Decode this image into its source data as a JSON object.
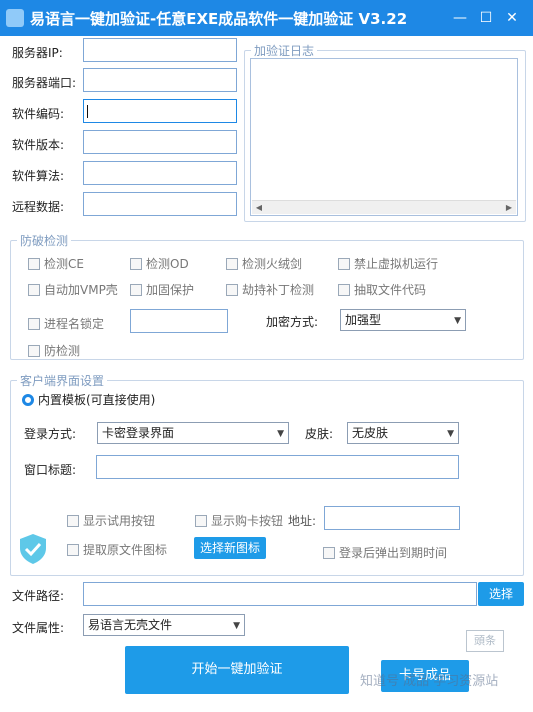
{
  "window": {
    "title": "易语言一键加验证-任意EXE成品软件一键加验证 V3.22",
    "min_glyph": "—",
    "max_glyph": "☐",
    "close_glyph": "✕"
  },
  "server": {
    "ip_label": "服务器IP:",
    "port_label": "服务器端口:",
    "code_label": "软件编码:",
    "version_label": "软件版本:",
    "algo_label": "软件算法:",
    "remote_label": "远程数据:"
  },
  "log": {
    "title": "加验证日志"
  },
  "protect": {
    "title": "防破检测",
    "items": [
      "检测CE",
      "检测OD",
      "检测火绒剑",
      "禁止虚拟机运行",
      "自动加VMP壳",
      "加固保护",
      "劫持补丁检测",
      "抽取文件代码",
      "进程名锁定",
      "防检测"
    ],
    "encrypt_label": "加密方式:",
    "encrypt_value": "加强型"
  },
  "client": {
    "title": "客户端界面设置",
    "template_label": "内置模板(可直接使用)",
    "login_label": "登录方式:",
    "login_value": "卡密登录界面",
    "skin_label": "皮肤:",
    "skin_value": "无皮肤",
    "window_title_label": "窗口标题:",
    "show_trial": "显示试用按钮",
    "show_buy": "显示购卡按钮",
    "address_label": "地址:",
    "extract_icon": "提取原文件图标",
    "choose_icon": "选择新图标",
    "popup_expire": "登录后弹出到期时间"
  },
  "file": {
    "path_label": "文件路径:",
    "choose": "选择",
    "attr_label": "文件属性:",
    "attr_value": "易语言无壳文件"
  },
  "actions": {
    "start": "开始一键加验证",
    "second": "卡号成品"
  },
  "watermark": {
    "text": "知道号 成品 学习资源站",
    "logo": "頭条"
  },
  "colors": {
    "accent": "#1e88e5",
    "button": "#1e9be8"
  }
}
